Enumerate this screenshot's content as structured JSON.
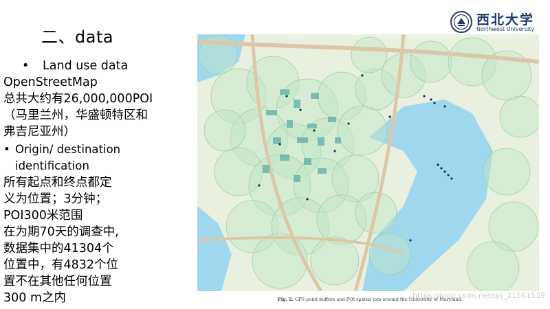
{
  "slide": {
    "title": "二、data"
  },
  "logo": {
    "name_cn": "西北大学",
    "name_en": "Northwest University"
  },
  "left": {
    "bullet1": "Land use data",
    "source": "OpenStreetMap",
    "poi_line": "总共大约有26,000,000POI",
    "region_line1": "（马里兰州，华盛顿特区和",
    "region_line2": "弗吉尼亚州）",
    "bullet2_line1": "Origin/ destination",
    "bullet2_line2": "identification",
    "para": [
      "所有起点和终点都定",
      "义为位置；3分钟；",
      "POI300米范围",
      "在为期70天的调查中,",
      "数据集中的41304个",
      "位置中，有4832个位",
      "置不在其他任何位置",
      "300 m之内"
    ]
  },
  "map": {
    "caption_label": "Fig. 2.",
    "caption_text": "GPS point buffers and POI spatial join around the University of Maryland.",
    "colors": {
      "water": "#9fd7ee",
      "land": "#eaf0e0",
      "buffer": "#c2e6c5",
      "road": "#dcc8a8",
      "building": "#5aaea8",
      "point": "#1a2a6c"
    }
  },
  "watermark": "https://blog.csdn.net/qq_21561539"
}
